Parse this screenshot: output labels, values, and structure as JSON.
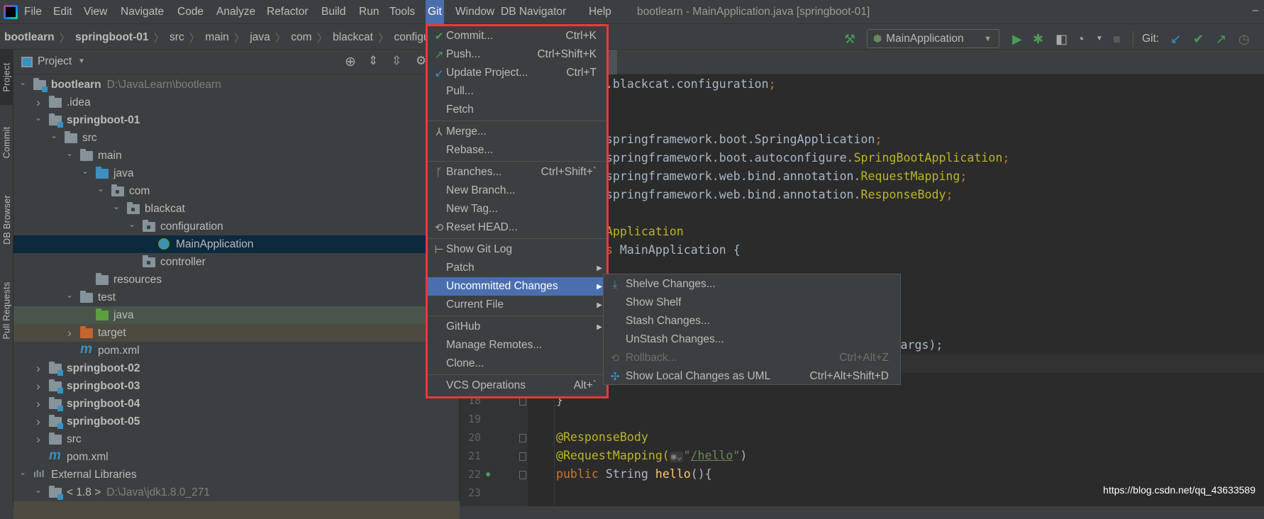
{
  "menubar": {
    "items": [
      "File",
      "Edit",
      "View",
      "Navigate",
      "Code",
      "Analyze",
      "Refactor",
      "Build",
      "Run",
      "Tools",
      "Git",
      "Window",
      "DB Navigator",
      "Help"
    ],
    "active": "Git",
    "window_title": "bootlearn - MainApplication.java [springboot-01]",
    "minimize": "–"
  },
  "breadcrumb": [
    "bootlearn",
    "springboot-01",
    "src",
    "main",
    "java",
    "com",
    "blackcat",
    "configuration"
  ],
  "toolbar": {
    "run_config": "MainApplication",
    "git_label": "Git:",
    "icons": [
      "build-hammer-icon",
      "run-icon",
      "debug-icon",
      "coverage-icon",
      "profiler-icon",
      "dropdown-icon",
      "stop-icon",
      "git-update-icon",
      "git-commit-icon",
      "git-push-icon",
      "git-history-icon"
    ]
  },
  "left_strip": [
    "Project",
    "Commit",
    "DB Browser",
    "Pull Requests"
  ],
  "project_panel": {
    "title": "Project",
    "tree": [
      {
        "label": "bootlearn",
        "hint": "D:\\JavaLearn\\bootlearn",
        "depth": 0,
        "arrow": "open",
        "icon": "module",
        "bold": true
      },
      {
        "label": ".idea",
        "depth": 1,
        "arrow": "closed",
        "icon": "folder"
      },
      {
        "label": "springboot-01",
        "depth": 1,
        "arrow": "open",
        "icon": "module",
        "bold": true
      },
      {
        "label": "src",
        "depth": 2,
        "arrow": "open",
        "icon": "folder"
      },
      {
        "label": "main",
        "depth": 3,
        "arrow": "open",
        "icon": "folder"
      },
      {
        "label": "java",
        "depth": 4,
        "arrow": "open",
        "icon": "source-folder"
      },
      {
        "label": "com",
        "depth": 5,
        "arrow": "open",
        "icon": "package"
      },
      {
        "label": "blackcat",
        "depth": 6,
        "arrow": "open",
        "icon": "package"
      },
      {
        "label": "configuration",
        "depth": 7,
        "arrow": "open",
        "icon": "package"
      },
      {
        "label": "MainApplication",
        "depth": 8,
        "arrow": "none",
        "icon": "spring-class",
        "selected": true
      },
      {
        "label": "controller",
        "depth": 7,
        "arrow": "none",
        "icon": "package"
      },
      {
        "label": "resources",
        "depth": 4,
        "arrow": "none",
        "icon": "resources-folder"
      },
      {
        "label": "test",
        "depth": 3,
        "arrow": "open",
        "icon": "folder"
      },
      {
        "label": "java",
        "depth": 4,
        "arrow": "none",
        "icon": "test-folder",
        "bg": "#49544a"
      },
      {
        "label": "target",
        "depth": 3,
        "arrow": "closed",
        "icon": "excluded-folder",
        "bg": "#4d4a40"
      },
      {
        "label": "pom.xml",
        "depth": 3,
        "arrow": "none",
        "icon": "maven"
      },
      {
        "label": "springboot-02",
        "depth": 1,
        "arrow": "closed",
        "icon": "module",
        "bold": true
      },
      {
        "label": "springboot-03",
        "depth": 1,
        "arrow": "closed",
        "icon": "module",
        "bold": true
      },
      {
        "label": "springboot-04",
        "depth": 1,
        "arrow": "closed",
        "icon": "module",
        "bold": true
      },
      {
        "label": "springboot-05",
        "depth": 1,
        "arrow": "closed",
        "icon": "module",
        "bold": true
      },
      {
        "label": "src",
        "depth": 1,
        "arrow": "closed",
        "icon": "folder"
      },
      {
        "label": "pom.xml",
        "depth": 1,
        "arrow": "none",
        "icon": "maven"
      },
      {
        "label": "External Libraries",
        "depth": 0,
        "arrow": "open",
        "icon": "libraries"
      },
      {
        "label": "< 1.8 >",
        "hint": "D:\\Java\\jdk1.8.0_271",
        "depth": 1,
        "arrow": "open",
        "icon": "jdk"
      }
    ]
  },
  "editor": {
    "line_numbers": [
      "18",
      "19",
      "20",
      "21",
      "22",
      "23"
    ],
    "code": {
      "l1": ".blackcat.configuration",
      "semi": ";",
      "l5": "springframework.boot.SpringApplication",
      "l6a": "springframework.boot.autoconfigure.",
      "l6b": "SpringBootApplication",
      "l7a": "springframework.web.bind.annotation.",
      "l7b": "RequestMapping",
      "l8a": "springframework.web.bind.annotation.",
      "l8b": "ResponseBody",
      "l10": "Application",
      "l11a": "s",
      "l11b": " MainApplication {",
      "l15": "args);",
      "l18": "}",
      "l20": "@ResponseBody",
      "l21a": "@RequestMapping(",
      "l21q": "\"",
      "l21b": "/hello",
      "l21c": ")",
      "l22a": "public",
      "l22b": " String ",
      "l22c": "hello",
      "l22d": "(){"
    }
  },
  "git_menu": {
    "groups": [
      [
        {
          "label": "Commit...",
          "shortcut": "Ctrl+K",
          "icon": "check-icon"
        },
        {
          "label": "Push...",
          "shortcut": "Ctrl+Shift+K",
          "icon": "push-arrow-icon"
        },
        {
          "label": "Update Project...",
          "shortcut": "Ctrl+T",
          "icon": "update-arrow-icon"
        },
        {
          "label": "Pull..."
        },
        {
          "label": "Fetch"
        }
      ],
      [
        {
          "label": "Merge...",
          "icon": "merge-icon"
        },
        {
          "label": "Rebase..."
        }
      ],
      [
        {
          "label": "Branches...",
          "shortcut": "Ctrl+Shift+`",
          "icon": "branch-icon"
        },
        {
          "label": "New Branch..."
        },
        {
          "label": "New Tag..."
        },
        {
          "label": "Reset HEAD...",
          "icon": "reset-icon"
        }
      ],
      [
        {
          "label": "Show Git Log",
          "icon": "git-log-icon"
        },
        {
          "label": "Patch",
          "submenu": true
        },
        {
          "label": "Uncommitted Changes",
          "submenu": true,
          "highlighted": true
        },
        {
          "label": "Current File",
          "submenu": true
        }
      ],
      [
        {
          "label": "GitHub",
          "submenu": true
        },
        {
          "label": "Manage Remotes..."
        },
        {
          "label": "Clone..."
        }
      ],
      [
        {
          "label": "VCS Operations",
          "shortcut": "Alt+`"
        }
      ]
    ]
  },
  "uncommitted_submenu": [
    {
      "label": "Shelve Changes...",
      "icon": "shelve-icon"
    },
    {
      "label": "Show Shelf"
    },
    {
      "label": "Stash Changes..."
    },
    {
      "label": "UnStash Changes..."
    },
    {
      "label": "Rollback...",
      "shortcut": "Ctrl+Alt+Z",
      "icon": "rollback-icon",
      "disabled": true
    },
    {
      "label": "Show Local Changes as UML",
      "shortcut": "Ctrl+Alt+Shift+D",
      "icon": "uml-icon"
    }
  ],
  "watermark": "https://blog.csdn.net/qq_43633589",
  "colors": {
    "highlight": "#4b6eaf",
    "annotation_border": "#f0373a",
    "selection": "#0d293e"
  }
}
